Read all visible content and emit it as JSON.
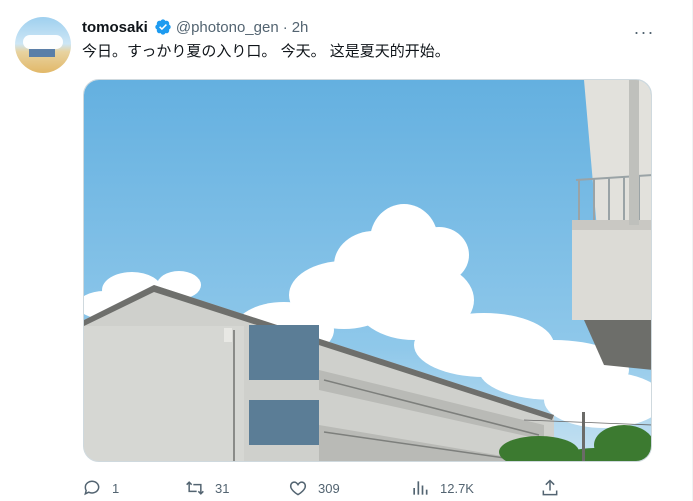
{
  "tweet": {
    "author_name": "tomosaki",
    "handle": "@photono_gen",
    "separator": "·",
    "time": "2h",
    "text": "今日。すっかり夏の入り口。 今天。 这是夏天的开始。",
    "more_label": "···"
  },
  "actions": {
    "reply_count": "1",
    "retweet_count": "31",
    "like_count": "309",
    "views_count": "12.7K"
  },
  "icons": {
    "verified": "verified-badge-icon",
    "more": "more-options-icon",
    "reply": "reply-icon",
    "retweet": "retweet-icon",
    "like": "heart-icon",
    "views": "views-icon",
    "share": "share-icon"
  },
  "colors": {
    "verified": "#1d9bf0",
    "text_secondary": "#536471",
    "sky": "#7cbde4",
    "building": "#d9d9d4"
  }
}
